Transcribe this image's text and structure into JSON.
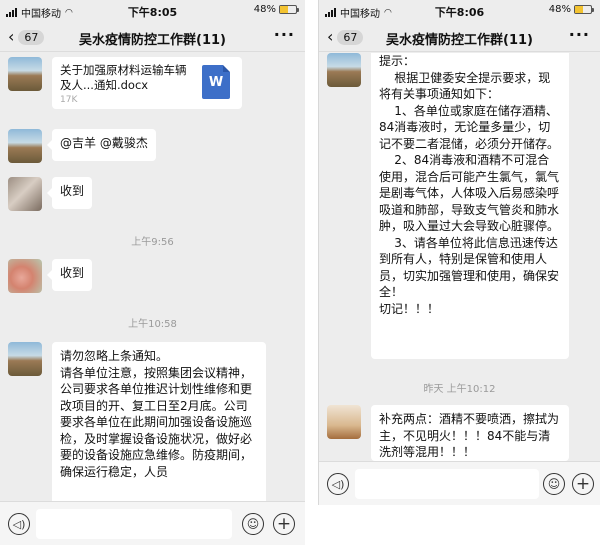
{
  "left_phone": {
    "status": {
      "carrier": "中国移动",
      "time": "下午8:05",
      "battery": "48%",
      "battery_level": 0.48
    },
    "nav": {
      "back_count": "67",
      "title": "吴水疫情防控工作群(11)",
      "more": "···"
    },
    "file": {
      "name": "关于加强原材料运输车辆及人...通知.docx",
      "size": "17K",
      "type_letter": "W"
    },
    "messages": {
      "mention": "@吉羊 @戴骏杰",
      "received_1": "收到",
      "received_2": "收到",
      "notice": "请勿忽略上条通知。\n请各单位注意，按照集团会议精神，公司要求各单位推迟计划性维修和更改项目的开、复工日至2月底。公司要求各单位在此期间加强设备设施巡检，及时掌握设备设施状况，做好必要的设备设施应急维修。防疫期间，确保运行稳定，人员"
    },
    "timestamps": {
      "t1": "上午9:56",
      "t2": "上午10:58"
    }
  },
  "right_phone": {
    "status": {
      "carrier": "中国移动",
      "time": "下午8:06",
      "battery": "48%",
      "battery_level": 0.48
    },
    "nav": {
      "back_count": "67",
      "title": "吴水疫情防控工作群(11)",
      "more": "···"
    },
    "messages": {
      "tips": "提示：\n    根据卫健委安全提示要求，现将有关事项通知如下：\n    1、各单位或家庭在储存酒精、84消毒液时，无论量多量少，切记不要二者混储，必须分开储存。\n    2、84消毒液和酒精不可混合使用，混合后可能产生氯气，氯气是剧毒气体，人体吸入后易感染呼吸道和肺部，导致支气管炎和肺水肿，吸入量过大会导致心脏骤停。\n    3、请各单位将此信息迅速传达到所有人，特别是保管和使用人员，切实加强管理和使用，确保安全！\n切记！！！",
      "supplement": "补充两点：酒精不要喷洒，擦拭为主，不见明火！！！84不能与清洗剂等混用！！！"
    },
    "timestamps": {
      "t1": "昨天 上午10:12"
    }
  },
  "icons": {
    "back": "‹",
    "voice": "◁)",
    "emoji": "☺",
    "plus": "+"
  }
}
